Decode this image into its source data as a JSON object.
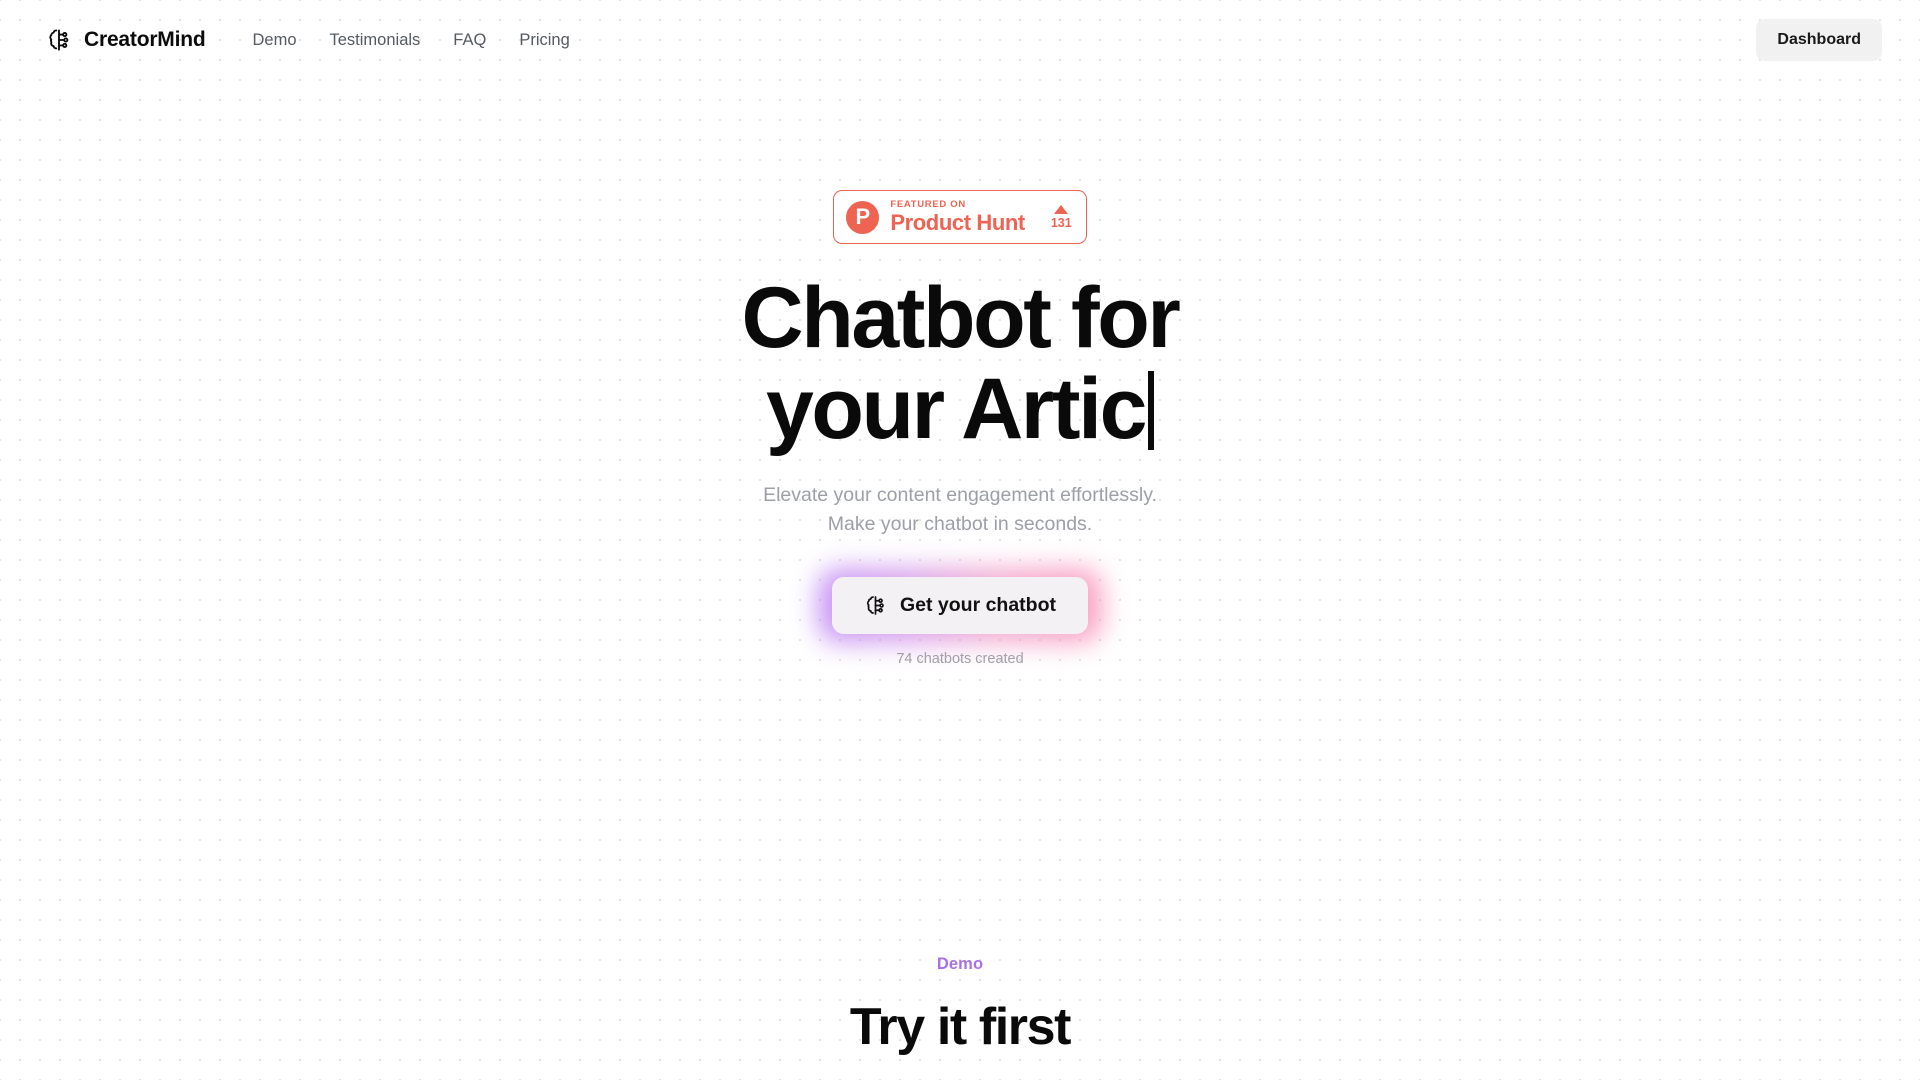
{
  "nav": {
    "brand": {
      "name": "CreatorMind",
      "icon": "brain-circuit-icon"
    },
    "links": [
      {
        "label": "Demo"
      },
      {
        "label": "Testimonials"
      },
      {
        "label": "FAQ"
      },
      {
        "label": "Pricing"
      }
    ],
    "dashboard_label": "Dashboard"
  },
  "hero": {
    "badge": {
      "logo_letter": "P",
      "featured_on": "FEATURED ON",
      "product": "Product Hunt",
      "upvotes": "131"
    },
    "headline_static": "Chatbot for your",
    "headline_typed": "Artic",
    "subtitle_line1": "Elevate your content engagement effortlessly.",
    "subtitle_line2": "Make your chatbot in seconds.",
    "cta_label": "Get your chatbot",
    "cta_icon": "brain-circuit-icon",
    "cta_note": "74 chatbots created"
  },
  "demo": {
    "eyebrow": "Demo",
    "title": "Try it first"
  },
  "colors": {
    "accent_purple": "#a970e8",
    "product_hunt_red": "#ee6352",
    "glow_left": "#b06cf0",
    "glow_right": "#f97ca8",
    "muted_text": "#9ca0a6"
  }
}
